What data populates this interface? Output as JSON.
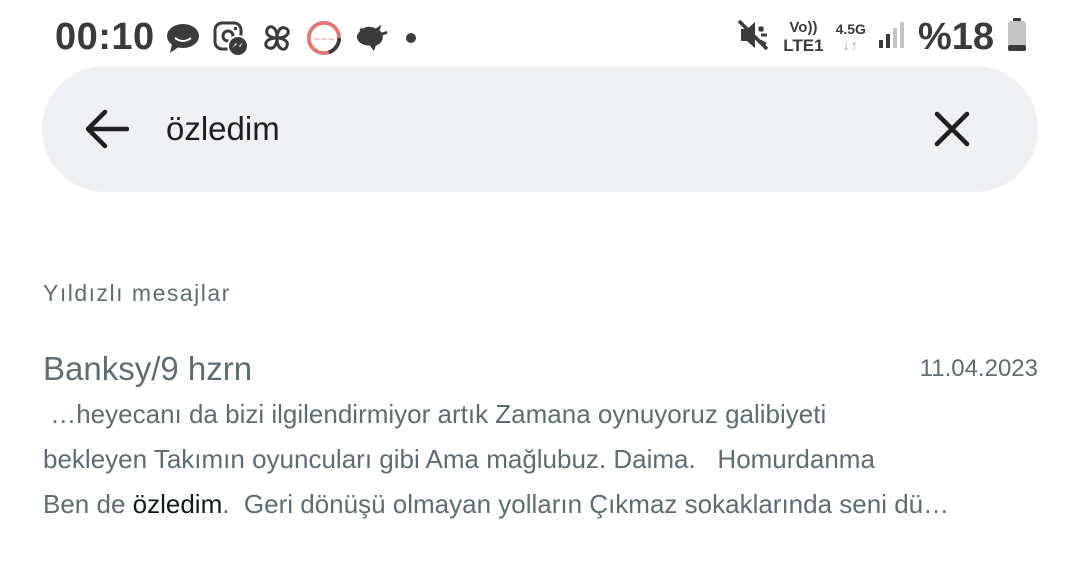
{
  "status_bar": {
    "time": "00:10",
    "notification_icons": [
      "chat-bubble-icon",
      "messenger-icon",
      "pinwheel-icon",
      "app-circle-icon",
      "bird-icon",
      "more-dot-icon"
    ],
    "volte_top": "Vo))",
    "volte_bottom": "LTE1",
    "network_type": "4.5G",
    "network_arrows": "↓↑",
    "battery": "%18"
  },
  "search": {
    "query": "özledim",
    "back_icon": "arrow-left-icon",
    "clear_icon": "close-icon"
  },
  "section": {
    "title": "Yıldızlı mesajlar"
  },
  "results": [
    {
      "title": "Banksy/9 hzrn",
      "date": "11.04.2023",
      "line1": " …heyecanı da bizi ilgilendirmiyor artık Zamana oynuyoruz galibiyeti",
      "line2": "bekleyen Takımın oyuncuları gibi Ama mağlubuz. Daima.   Homurdanma",
      "line3_before": "Ben de ",
      "line3_match": "özledim",
      "line3_after": ".  Geri dönüşü olmayan yolların Çıkmaz sokaklarında seni dü…"
    }
  ],
  "colors": {
    "search_bg": "#eef0f4",
    "muted_text": "#5f6c75",
    "highlight_text": "#111b21",
    "status_text": "#3b3b3b"
  }
}
